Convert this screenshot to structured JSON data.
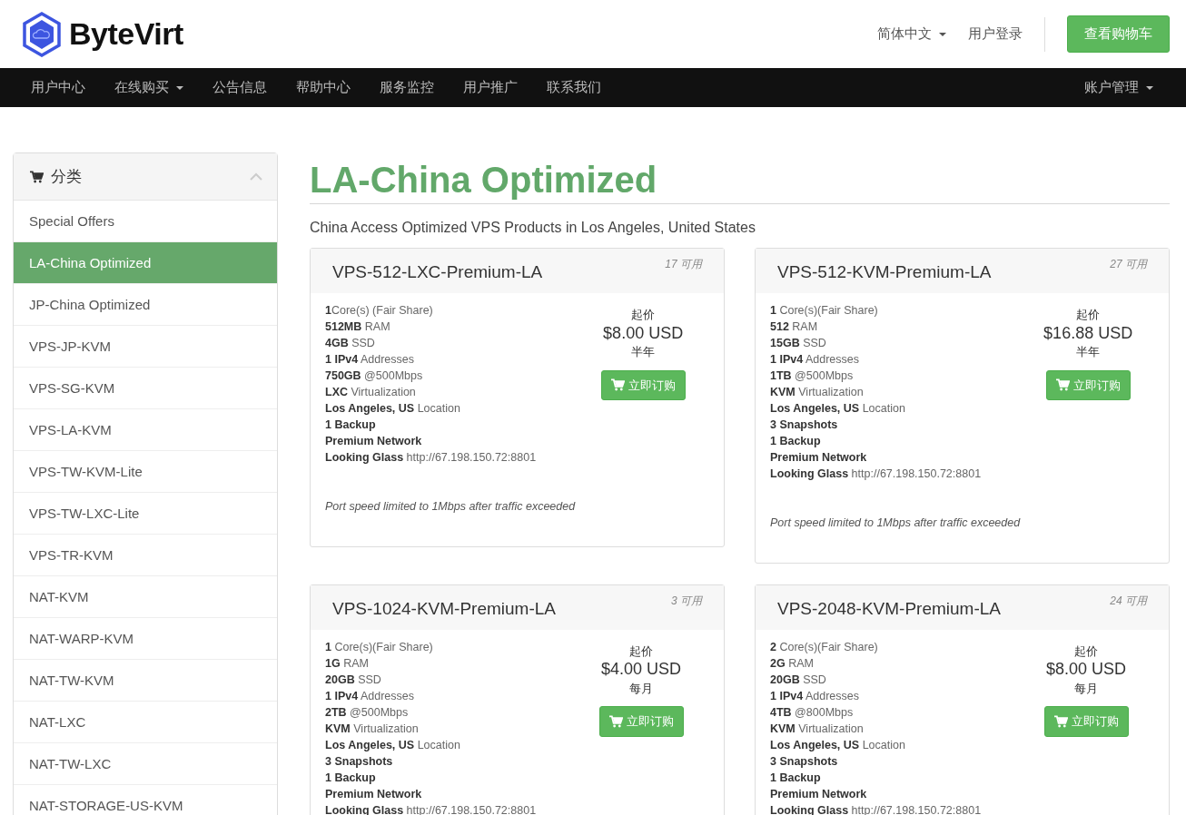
{
  "header": {
    "logo": "ByteVirt",
    "language": "简体中文",
    "login": "用户登录",
    "cart_button": "查看购物车"
  },
  "nav": {
    "items": [
      {
        "label": "用户中心",
        "dropdown": false
      },
      {
        "label": "在线购买",
        "dropdown": true
      },
      {
        "label": "公告信息",
        "dropdown": false
      },
      {
        "label": "帮助中心",
        "dropdown": false
      },
      {
        "label": "服务监控",
        "dropdown": false
      },
      {
        "label": "用户推广",
        "dropdown": false
      },
      {
        "label": "联系我们",
        "dropdown": false
      }
    ],
    "account": {
      "label": "账户管理",
      "dropdown": true
    }
  },
  "sidebar": {
    "title": "分类",
    "items": [
      {
        "label": "Special Offers",
        "selected": false
      },
      {
        "label": "LA-China Optimized",
        "selected": true
      },
      {
        "label": "JP-China Optimized",
        "selected": false
      },
      {
        "label": "VPS-JP-KVM",
        "selected": false
      },
      {
        "label": "VPS-SG-KVM",
        "selected": false
      },
      {
        "label": "VPS-LA-KVM",
        "selected": false
      },
      {
        "label": "VPS-TW-KVM-Lite",
        "selected": false
      },
      {
        "label": "VPS-TW-LXC-Lite",
        "selected": false
      },
      {
        "label": "VPS-TR-KVM",
        "selected": false
      },
      {
        "label": "NAT-KVM",
        "selected": false
      },
      {
        "label": "NAT-WARP-KVM",
        "selected": false
      },
      {
        "label": "NAT-TW-KVM",
        "selected": false
      },
      {
        "label": "NAT-LXC",
        "selected": false
      },
      {
        "label": "NAT-TW-LXC",
        "selected": false
      },
      {
        "label": "NAT-STORAGE-US-KVM",
        "selected": false
      }
    ]
  },
  "page": {
    "title": "LA-China Optimized",
    "subtitle": "China Access Optimized VPS Products in Los Angeles, United States"
  },
  "products": [
    {
      "name": "VPS-512-LXC-Premium-LA",
      "available": "17 可用",
      "specs": [
        "**1**Core(s) (Fair Share)",
        "**512MB** RAM",
        "**4GB** SSD",
        "**1 IPv4** Addresses",
        "**750GB** @500Mbps",
        "**LXC** Virtualization",
        "**Los Angeles, US** Location",
        "**1 Backup**",
        "**Premium Network**",
        "**Looking Glass** http://67.198.150.72:8801"
      ],
      "note": "Port speed limited to 1Mbps after traffic exceeded",
      "price_label": "起价",
      "price": "$8.00 USD",
      "cycle": "半年",
      "order_button": "立即订购"
    },
    {
      "name": "VPS-512-KVM-Premium-LA",
      "available": "27 可用",
      "specs": [
        "**1** Core(s)(Fair Share)",
        "**512** RAM",
        "**15GB** SSD",
        "**1 IPv4** Addresses",
        "**1TB** @500Mbps",
        "**KVM** Virtualization",
        "**Los Angeles, US** Location",
        "**3 Snapshots**",
        "**1 Backup**",
        "**Premium Network**",
        "**Looking Glass** http://67.198.150.72:8801"
      ],
      "note": "Port speed limited to 1Mbps after traffic exceeded",
      "price_label": "起价",
      "price": "$16.88 USD",
      "cycle": "半年",
      "order_button": "立即订购"
    },
    {
      "name": "VPS-1024-KVM-Premium-LA",
      "available": "3 可用",
      "specs": [
        "**1** Core(s)(Fair Share)",
        "**1G** RAM",
        "**20GB** SSD",
        "**1 IPv4** Addresses",
        "**2TB** @500Mbps",
        "**KVM** Virtualization",
        "**Los Angeles, US** Location",
        "**3 Snapshots**",
        "**1 Backup**",
        "**Premium Network**",
        "**Looking Glass** http://67.198.150.72:8801"
      ],
      "price_label": "起价",
      "price": "$4.00 USD",
      "cycle": "每月",
      "order_button": "立即订购"
    },
    {
      "name": "VPS-2048-KVM-Premium-LA",
      "available": "24 可用",
      "specs": [
        "**2** Core(s)(Fair Share)",
        "**2G** RAM",
        "**20GB** SSD",
        "**1 IPv4** Addresses",
        "**4TB** @800Mbps",
        "**KVM** Virtualization",
        "**Los Angeles, US** Location",
        "**3 Snapshots**",
        "**1 Backup**",
        "**Premium Network**",
        "**Looking Glass** http://67.198.150.72:8801"
      ],
      "price_label": "起价",
      "price": "$8.00 USD",
      "cycle": "每月",
      "order_button": "立即订购"
    }
  ]
}
